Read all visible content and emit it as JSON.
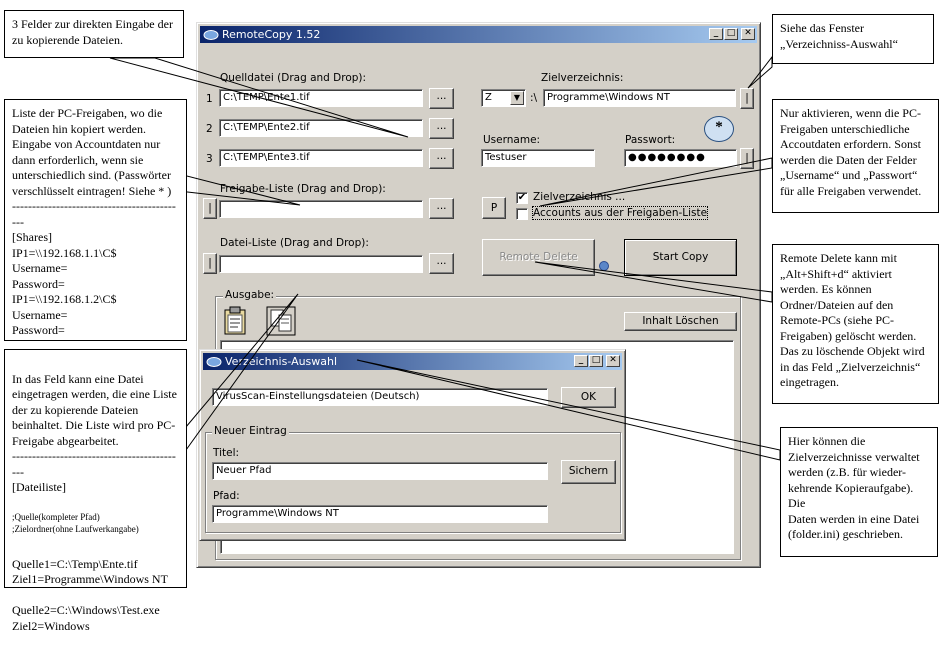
{
  "main_window": {
    "title": "RemoteCopy 1.52",
    "labels": {
      "source_file": "Quelldatei (Drag and Drop):",
      "share_list": "Freigabe-Liste (Drag and Drop):",
      "file_list": "Datei-Liste (Drag and Drop):",
      "target_dir": "Zielverzeichnis:",
      "username": "Username:",
      "password": "Passwort:",
      "output": "Ausgabe:"
    },
    "row_numbers": [
      "1",
      "2",
      "3"
    ],
    "source_files": [
      "C:\\TEMP\\Ente1.tif",
      "C:\\TEMP\\Ente2.tif",
      "C:\\TEMP\\Ente3.tif"
    ],
    "share_list_value": "",
    "file_list_value": "",
    "drive_letter": "Z",
    "drive_separator": ":\\",
    "target_dir_value": "Programme\\Windows NT",
    "username_value": "Testuser",
    "password_value": "●●●●●●●●",
    "browse_label": "...",
    "side_button_label": "|",
    "p_button": "P",
    "check_target_dir": {
      "label": "Zielverzeichnis ...",
      "checked": true
    },
    "check_accounts": {
      "label": "Accounts aus der Freigaben-Liste",
      "checked": false
    },
    "remote_delete": "Remote Delete",
    "start_copy": "Start Copy",
    "clear_output": "Inhalt Löschen",
    "star_marker": "*"
  },
  "dir_window": {
    "title": "Verzeichnis-Auswahl",
    "selected": "VirusScan-Einstellungsdateien (Deutsch)",
    "ok": "OK",
    "group_title": "Neuer Eintrag",
    "title_label": "Titel:",
    "title_value": "Neuer Pfad",
    "save": "Sichern",
    "path_label": "Pfad:",
    "path_value": "Programme\\Windows NT"
  },
  "notes": {
    "n1": "3 Felder zur direkten Eingabe der\nzu kopierende Dateien.",
    "n2": "Liste der PC-Freigaben, wo die\nDateien hin kopiert werden.\nEingabe von Accountdaten nur\ndann erforderlich, wenn sie\nunterschiedlich sind. (Passwörter\nverschlüsselt eintragen! Siehe * )\n--------------------------------------------\n[Shares]\nIP1=\\\\192.168.1.1\\C$\nUsername=\nPassword=\nIP1=\\\\192.168.1.2\\C$\nUsername=\nPassword=",
    "n3": "In das Feld kann eine Datei\neingetragen werden, die eine Liste\nder zu kopierende Dateien\nbeinhaltet. Die Liste wird pro PC-\nFreigabe abgearbeitet.\n--------------------------------------------\n[Dateiliste]",
    "n3_small": ";Quelle(kompleter Pfad)\n;Zielordner(ohne Laufwerkangabe)",
    "n3_tail": "Quelle1=C:\\Temp\\Ente.tif\nZiel1=Programme\\Windows NT\n\nQuelle2=C:\\Windows\\Test.exe\nZiel2=Windows",
    "n4": "Siehe das Fenster\n„Verzeichniss-Auswahl“",
    "n5": "Nur aktivieren, wenn die PC-\nFreigaben unterschiedliche\nAccoutdaten erfordern. Sonst\nwerden die Daten der Felder\n„Username“ und „Passwort“\nfür alle Freigaben verwendet.",
    "n6": "Remote Delete kann mit\n„Alt+Shift+d“ aktiviert\nwerden. Es können\nOrdner/Dateien auf den\nRemote-PCs (siehe PC-\nFreigaben) gelöscht werden.\nDas zu löschende Objekt wird\nin das Feld „Zielverzeichnis“\neingetragen.",
    "n7": "Hier können die\nZielverzeichnisse verwaltet\nwerden (z.B. für wieder-\nkehrende Kopieraufgabe). Die\nDaten werden in eine Datei\n(folder.ini) geschrieben."
  }
}
